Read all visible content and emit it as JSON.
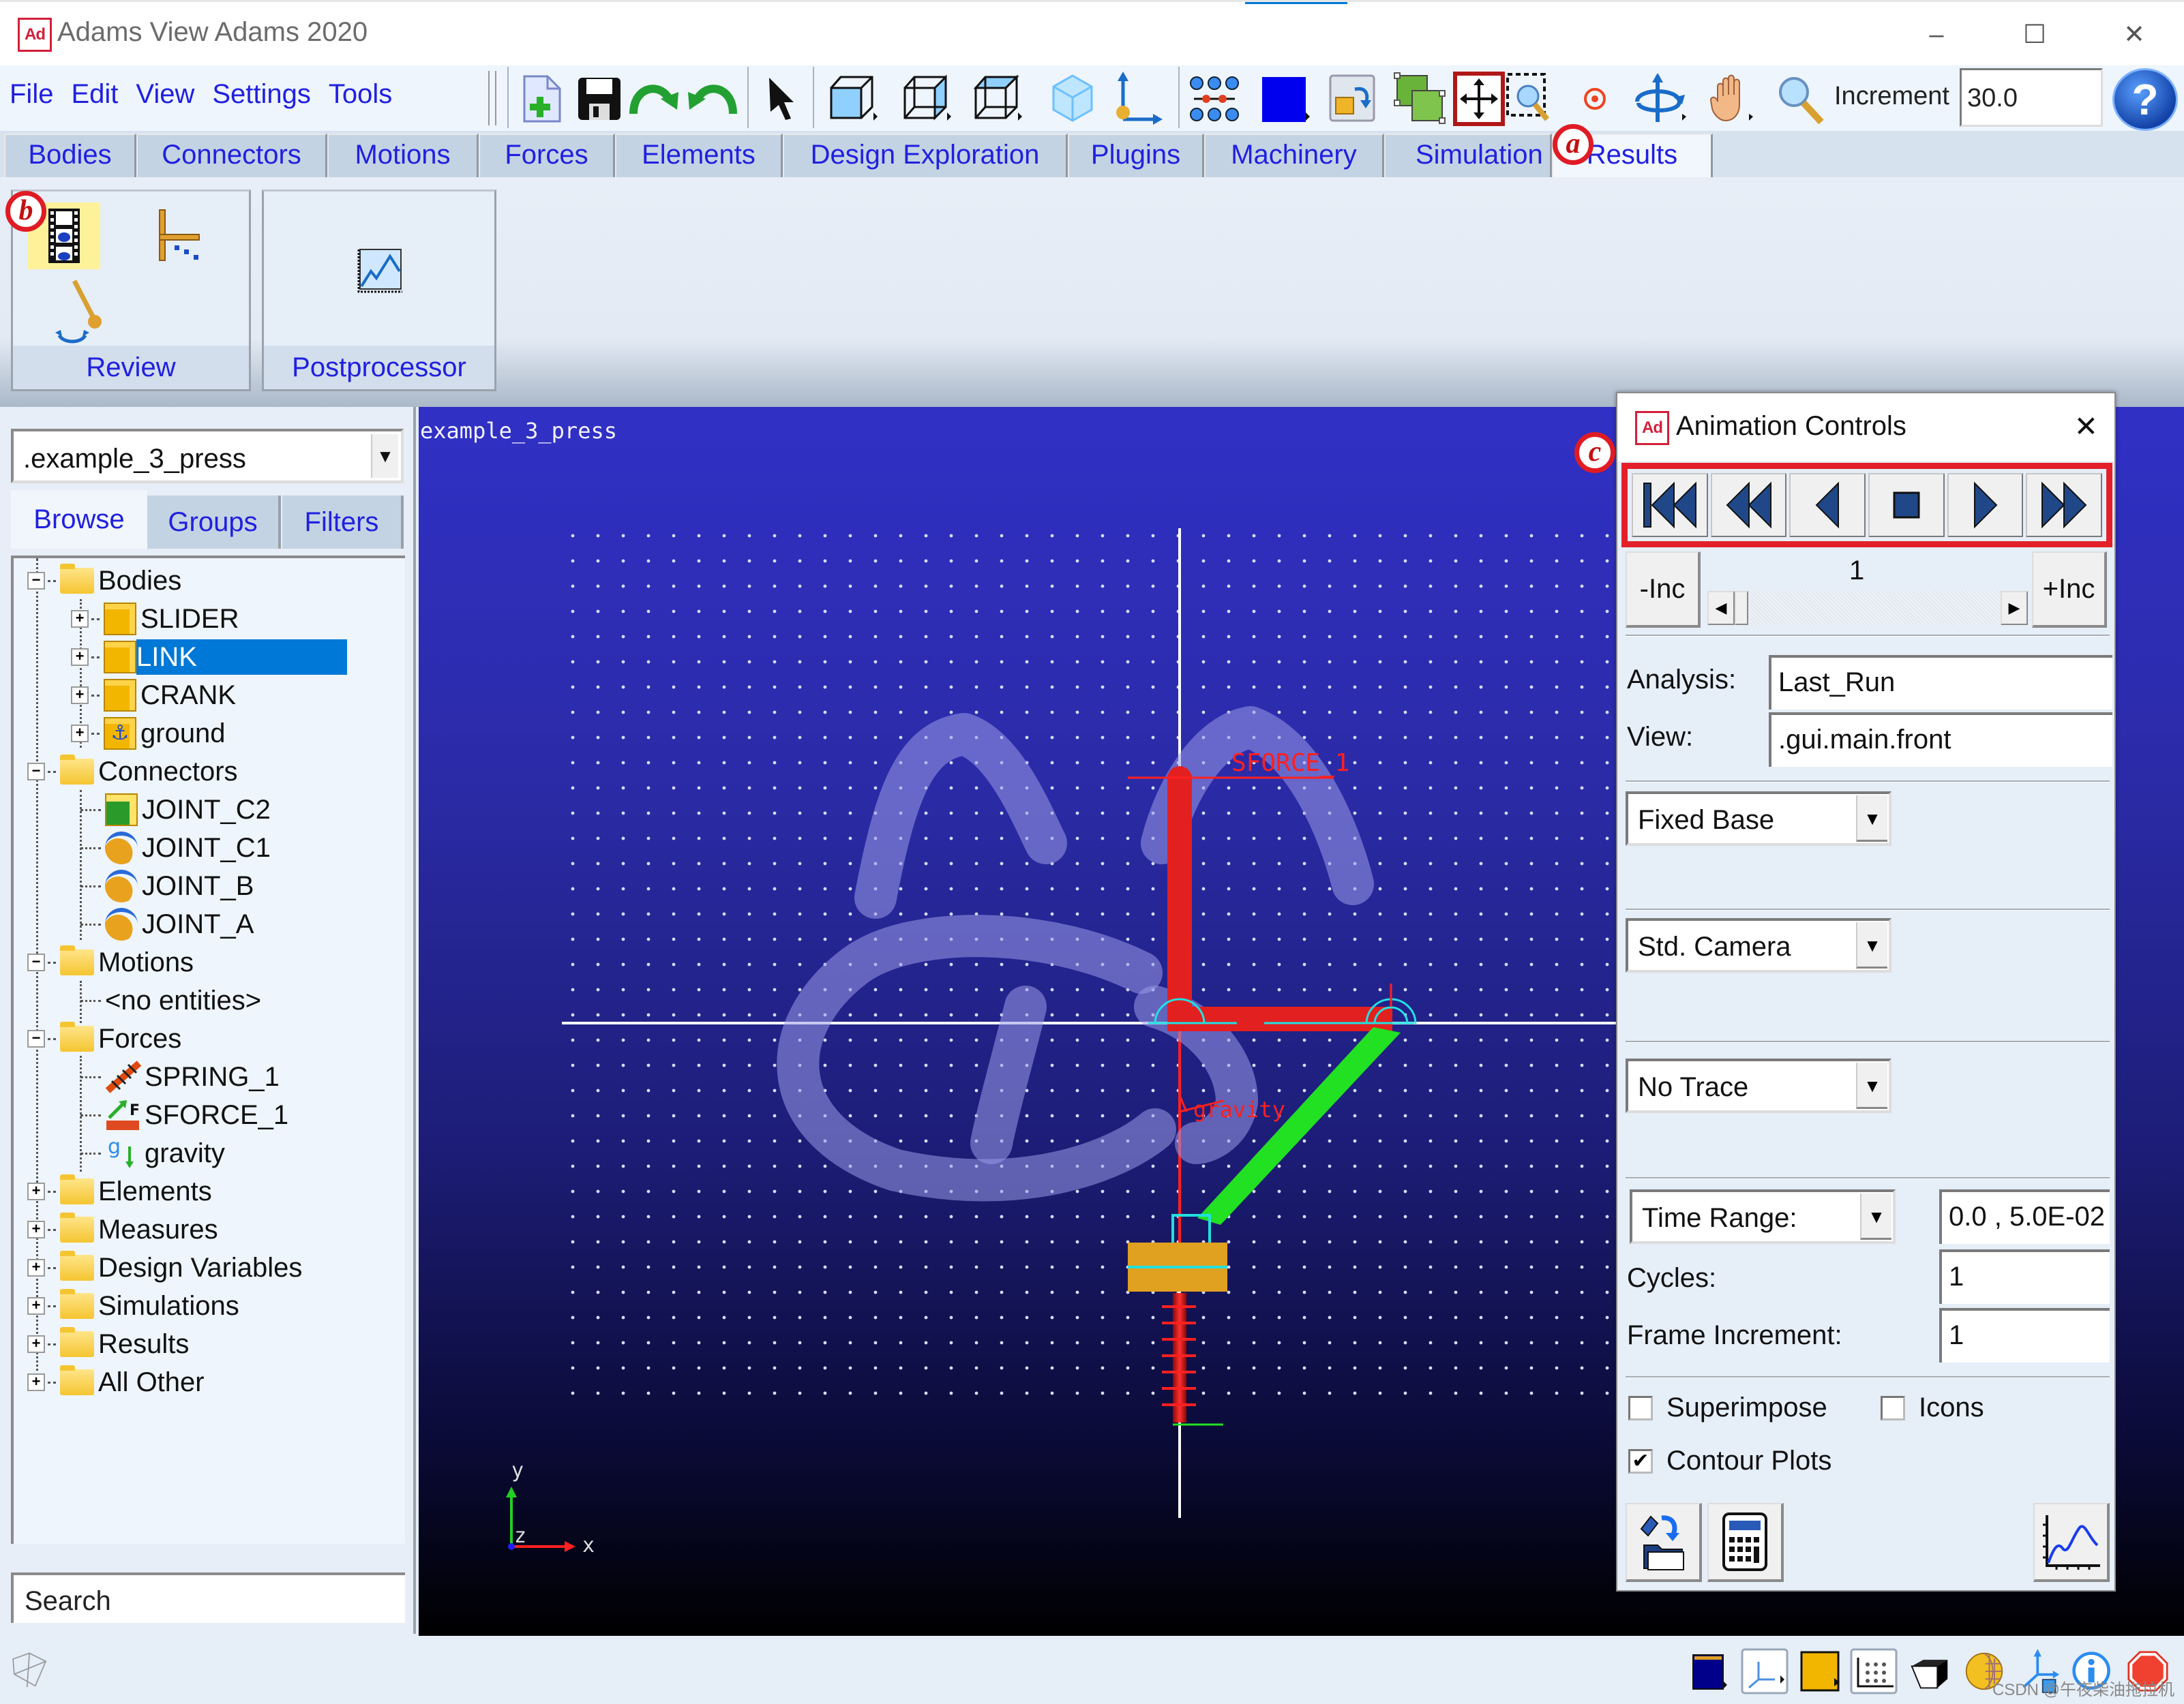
{
  "window": {
    "app_logo": "Ad",
    "title": "Adams View Adams 2020",
    "controls": {
      "minimize": "–",
      "maximize": "☐",
      "close": "✕"
    }
  },
  "menu": [
    "File",
    "Edit",
    "View",
    "Settings",
    "Tools"
  ],
  "toolbar": {
    "icons": [
      "new-model-icon",
      "save-icon",
      "redo-icon",
      "undo-icon",
      "select-pointer-icon",
      "front-view-icon",
      "right-view-icon",
      "top-view-icon",
      "iso-view-icon",
      "coordinate-system-icon",
      "grid-toggle-icon",
      "color-swatch-icon",
      "render-mode-icon",
      "group-icon",
      "fit-view-icon",
      "zoom-box-icon",
      "center-icon",
      "rotate-icon",
      "pan-hand-icon",
      "zoom-icon"
    ],
    "increment_label": "Increment",
    "increment_value": "30.0",
    "help": "?"
  },
  "tabs": [
    {
      "label": "Bodies"
    },
    {
      "label": "Connectors"
    },
    {
      "label": "Motions"
    },
    {
      "label": "Forces"
    },
    {
      "label": "Elements"
    },
    {
      "label": "Design Exploration"
    },
    {
      "label": "Plugins"
    },
    {
      "label": "Machinery"
    },
    {
      "label": "Simulation"
    },
    {
      "label": "Results",
      "active": true
    }
  ],
  "ribbon": {
    "groups": [
      {
        "label": "Review",
        "buttons": [
          "animation-controls",
          "plot-tracking",
          "measure"
        ]
      },
      {
        "label": "Postprocessor",
        "buttons": [
          "postprocessor"
        ]
      }
    ]
  },
  "callouts": {
    "a": "a",
    "b": "b",
    "c": "c"
  },
  "left_panel": {
    "model": ".example_3_press",
    "tabs": [
      {
        "label": "Browse",
        "active": true
      },
      {
        "label": "Groups"
      },
      {
        "label": "Filters"
      }
    ],
    "tree": [
      {
        "label": "Bodies",
        "level": 0,
        "expanded": true,
        "icon": "folder-open"
      },
      {
        "label": "SLIDER",
        "level": 1,
        "expandable": true,
        "icon": "part"
      },
      {
        "label": "LINK",
        "level": 1,
        "expandable": true,
        "icon": "part",
        "selected": true
      },
      {
        "label": "CRANK",
        "level": 1,
        "expandable": true,
        "icon": "part"
      },
      {
        "label": "ground",
        "level": 1,
        "expandable": true,
        "icon": "ground"
      },
      {
        "label": "Connectors",
        "level": 0,
        "expanded": true,
        "icon": "folder-open"
      },
      {
        "label": "JOINT_C2",
        "level": 1,
        "icon": "translational-joint"
      },
      {
        "label": "JOINT_C1",
        "level": 1,
        "icon": "revolute-joint"
      },
      {
        "label": "JOINT_B",
        "level": 1,
        "icon": "revolute-joint"
      },
      {
        "label": "JOINT_A",
        "level": 1,
        "icon": "revolute-joint"
      },
      {
        "label": "Motions",
        "level": 0,
        "expanded": true,
        "icon": "folder-open"
      },
      {
        "label": "<no entities>",
        "level": 1,
        "icon": "none"
      },
      {
        "label": "Forces",
        "level": 0,
        "expanded": true,
        "icon": "folder-open"
      },
      {
        "label": "SPRING_1",
        "level": 1,
        "icon": "spring"
      },
      {
        "label": "SFORCE_1",
        "level": 1,
        "icon": "sforce"
      },
      {
        "label": "gravity",
        "level": 1,
        "icon": "gravity"
      },
      {
        "label": "Elements",
        "level": 0,
        "expandable": true,
        "icon": "folder"
      },
      {
        "label": "Measures",
        "level": 0,
        "expandable": true,
        "icon": "folder"
      },
      {
        "label": "Design Variables",
        "level": 0,
        "expandable": true,
        "icon": "folder"
      },
      {
        "label": "Simulations",
        "level": 0,
        "expandable": true,
        "icon": "folder"
      },
      {
        "label": "Results",
        "level": 0,
        "expandable": true,
        "icon": "folder"
      },
      {
        "label": "All Other",
        "level": 0,
        "expandable": true,
        "icon": "folder"
      }
    ],
    "search_placeholder": "Search"
  },
  "viewport": {
    "title": "example_3_press",
    "labels": {
      "sforce": "SFORCE_1",
      "gravity": "gravity"
    },
    "triad": {
      "x": "x",
      "y": "y",
      "z": "z"
    },
    "colors": {
      "crank": "#e32020",
      "link": "#22e022",
      "slider": "#e0a020",
      "spring": "#e02020",
      "marker": "#22e0e0"
    }
  },
  "animation_controls": {
    "title": "Animation Controls",
    "close": "✕",
    "playback": [
      "rewind-to-start",
      "play-reverse",
      "step-back",
      "stop",
      "play-forward",
      "fast-forward"
    ],
    "minus_inc": "-Inc",
    "plus_inc": "+Inc",
    "frame": "1",
    "analysis_label": "Analysis:",
    "analysis_value": "Last_Run",
    "view_label": "View:",
    "view_value": ".gui.main.front",
    "base_mode": "Fixed Base",
    "camera_mode": "Std. Camera",
    "trace_mode": "No Trace",
    "range_mode": "Time Range:",
    "range_value": "0.0 , 5.0E-02",
    "cycles_label": "Cycles:",
    "cycles_value": "1",
    "frame_inc_label": "Frame Increment:",
    "frame_inc_value": "1",
    "superimpose": {
      "label": "Superimpose",
      "checked": false
    },
    "icons": {
      "label": "Icons",
      "checked": false
    },
    "contour_plots": {
      "label": "Contour Plots",
      "checked": true
    }
  },
  "statusbar": {
    "icons": [
      "background-color-icon",
      "triad-toggle-icon",
      "part-color-icon",
      "grid-settings-icon",
      "render-icon",
      "shading-sphere-icon",
      "working-grid-icon",
      "info-icon",
      "stop-icon"
    ],
    "watermark": "CSDN @午夜柴油拖拉机"
  }
}
